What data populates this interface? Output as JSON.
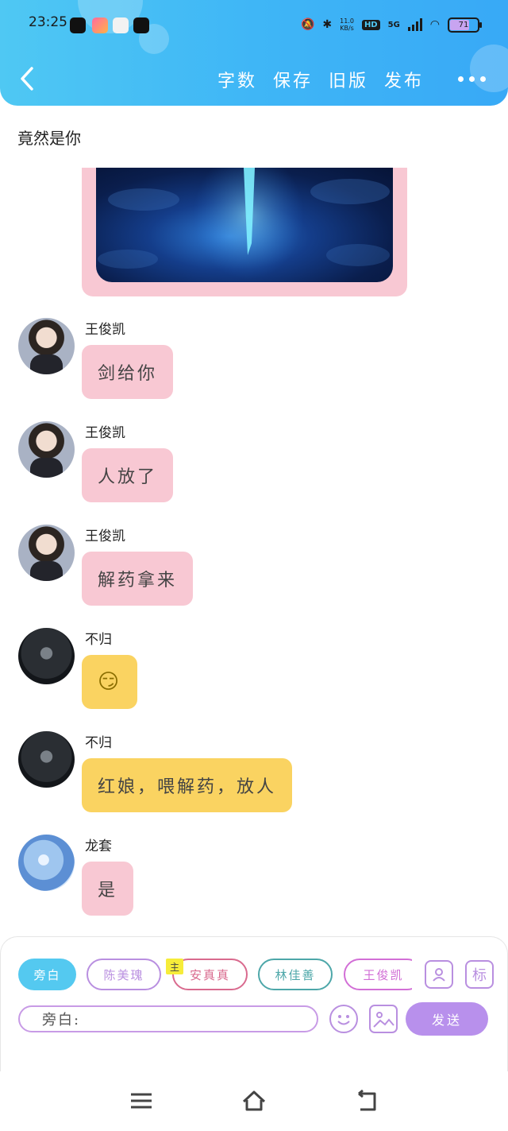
{
  "status_bar": {
    "time": "23:25",
    "net_speed_value": "11.0",
    "net_speed_unit": "KB/s",
    "hd": "HD",
    "network": "5G",
    "battery": "71"
  },
  "nav": {
    "actions": [
      "字数",
      "保存",
      "旧版",
      "发布"
    ]
  },
  "scene": {
    "title": "竟然是你"
  },
  "messages": [
    {
      "name": "王俊凯",
      "text": "剑给你"
    },
    {
      "name": "王俊凯",
      "text": "人放了"
    },
    {
      "name": "王俊凯",
      "text": "解药拿来"
    },
    {
      "name": "不归",
      "text": "😏"
    },
    {
      "name": "不归",
      "text": "红娘，喂解药，放人"
    },
    {
      "name": "龙套",
      "text": "是"
    }
  ],
  "composer": {
    "chips": [
      "旁白",
      "陈美瑰",
      "安真真",
      "林佳善",
      "王俊凯"
    ],
    "main_tag": "主",
    "mark_button": "标",
    "input_prefix": "旁白:",
    "send": "发送"
  },
  "colors": {
    "header": "#3fb6f6",
    "pink_bubble": "#f8c8d3",
    "yellow_bubble": "#fad361",
    "accent_purple": "#b890ec"
  }
}
